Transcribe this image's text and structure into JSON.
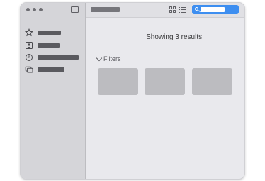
{
  "results": {
    "text": "Showing 3 results."
  },
  "filters": {
    "label": "Filters"
  },
  "sidebar": {
    "items": [
      {
        "icon": "star-icon"
      },
      {
        "icon": "contact-card-icon"
      },
      {
        "icon": "clock-icon"
      },
      {
        "icon": "folders-icon"
      }
    ]
  },
  "toolbar": {
    "view_options": [
      "grid-view-icon",
      "list-view-icon"
    ]
  },
  "colors": {
    "accent": "#3d8ef0",
    "sidebar_bg": "#d5d5d9",
    "content_bg": "#e9e9ed",
    "card": "#bcbcc0"
  }
}
